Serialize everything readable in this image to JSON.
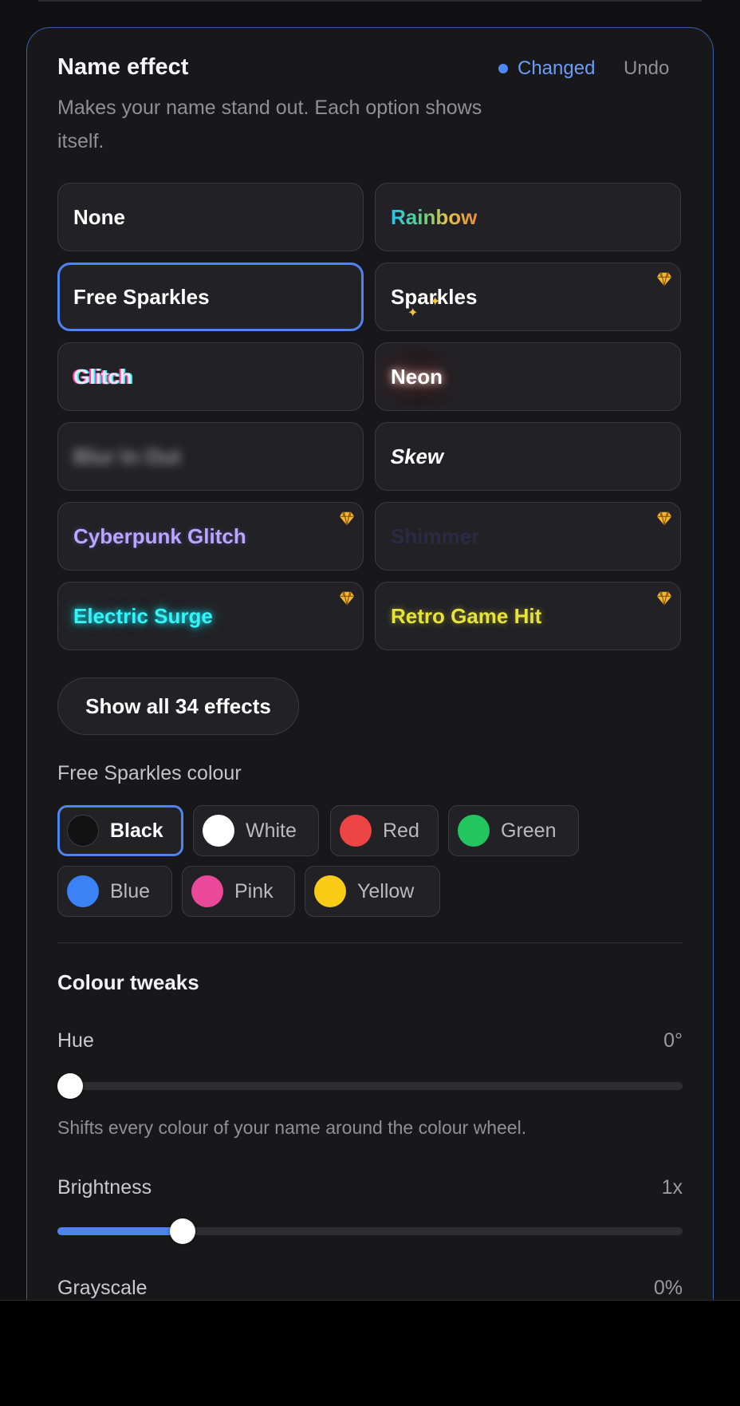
{
  "section": {
    "title": "Name effect",
    "description": "Makes your name stand out. Each option shows itself.",
    "status": "Changed",
    "undo_label": "Undo"
  },
  "effects": [
    {
      "label": "None",
      "style": "plain",
      "premium": false,
      "selected": false
    },
    {
      "label": "Rainbow",
      "style": "rainbow",
      "premium": false,
      "selected": false
    },
    {
      "label": "Free Sparkles",
      "style": "plain",
      "premium": false,
      "selected": true
    },
    {
      "label": "Sparkles",
      "style": "sparkles",
      "premium": true,
      "selected": false
    },
    {
      "label": "Glitch",
      "style": "glitch",
      "premium": false,
      "selected": false
    },
    {
      "label": "Neon",
      "style": "neon",
      "premium": false,
      "selected": false
    },
    {
      "label": "Blur In Out",
      "style": "blur",
      "premium": false,
      "selected": false
    },
    {
      "label": "Skew",
      "style": "skew",
      "premium": false,
      "selected": false
    },
    {
      "label": "Cyberpunk Glitch",
      "style": "cyber",
      "premium": true,
      "selected": false
    },
    {
      "label": "Shimmer",
      "style": "shimmer",
      "premium": true,
      "selected": false
    },
    {
      "label": "Electric Surge",
      "style": "electric",
      "premium": true,
      "selected": false
    },
    {
      "label": "Retro Game Hit",
      "style": "retro",
      "premium": true,
      "selected": false
    }
  ],
  "show_all_label": "Show all 34 effects",
  "colour": {
    "title": "Free Sparkles colour",
    "options": [
      {
        "label": "Black",
        "swatch": "#121212",
        "selected": true
      },
      {
        "label": "White",
        "swatch": "#ffffff",
        "selected": false
      },
      {
        "label": "Red",
        "swatch": "#ef4444",
        "selected": false
      },
      {
        "label": "Green",
        "swatch": "#22c55e",
        "selected": false
      },
      {
        "label": "Blue",
        "swatch": "#3b82f6",
        "selected": false
      },
      {
        "label": "Pink",
        "swatch": "#ec4899",
        "selected": false
      },
      {
        "label": "Yellow",
        "swatch": "#facc15",
        "selected": false
      }
    ]
  },
  "tweaks": {
    "title": "Colour tweaks",
    "hue": {
      "label": "Hue",
      "value": "0°",
      "fraction": 0.0,
      "hint": "Shifts every colour of your name around the colour wheel."
    },
    "brightness": {
      "label": "Brightness",
      "value": "1x",
      "fraction": 0.2
    },
    "grayscale": {
      "label": "Grayscale",
      "value": "0%"
    }
  },
  "colors": {
    "accent": "#4e84f2",
    "premium_gem": "#f5b731",
    "card_border": "#3b5fa6"
  },
  "icons": {
    "premium": "gem-icon",
    "status": "dot-icon"
  }
}
